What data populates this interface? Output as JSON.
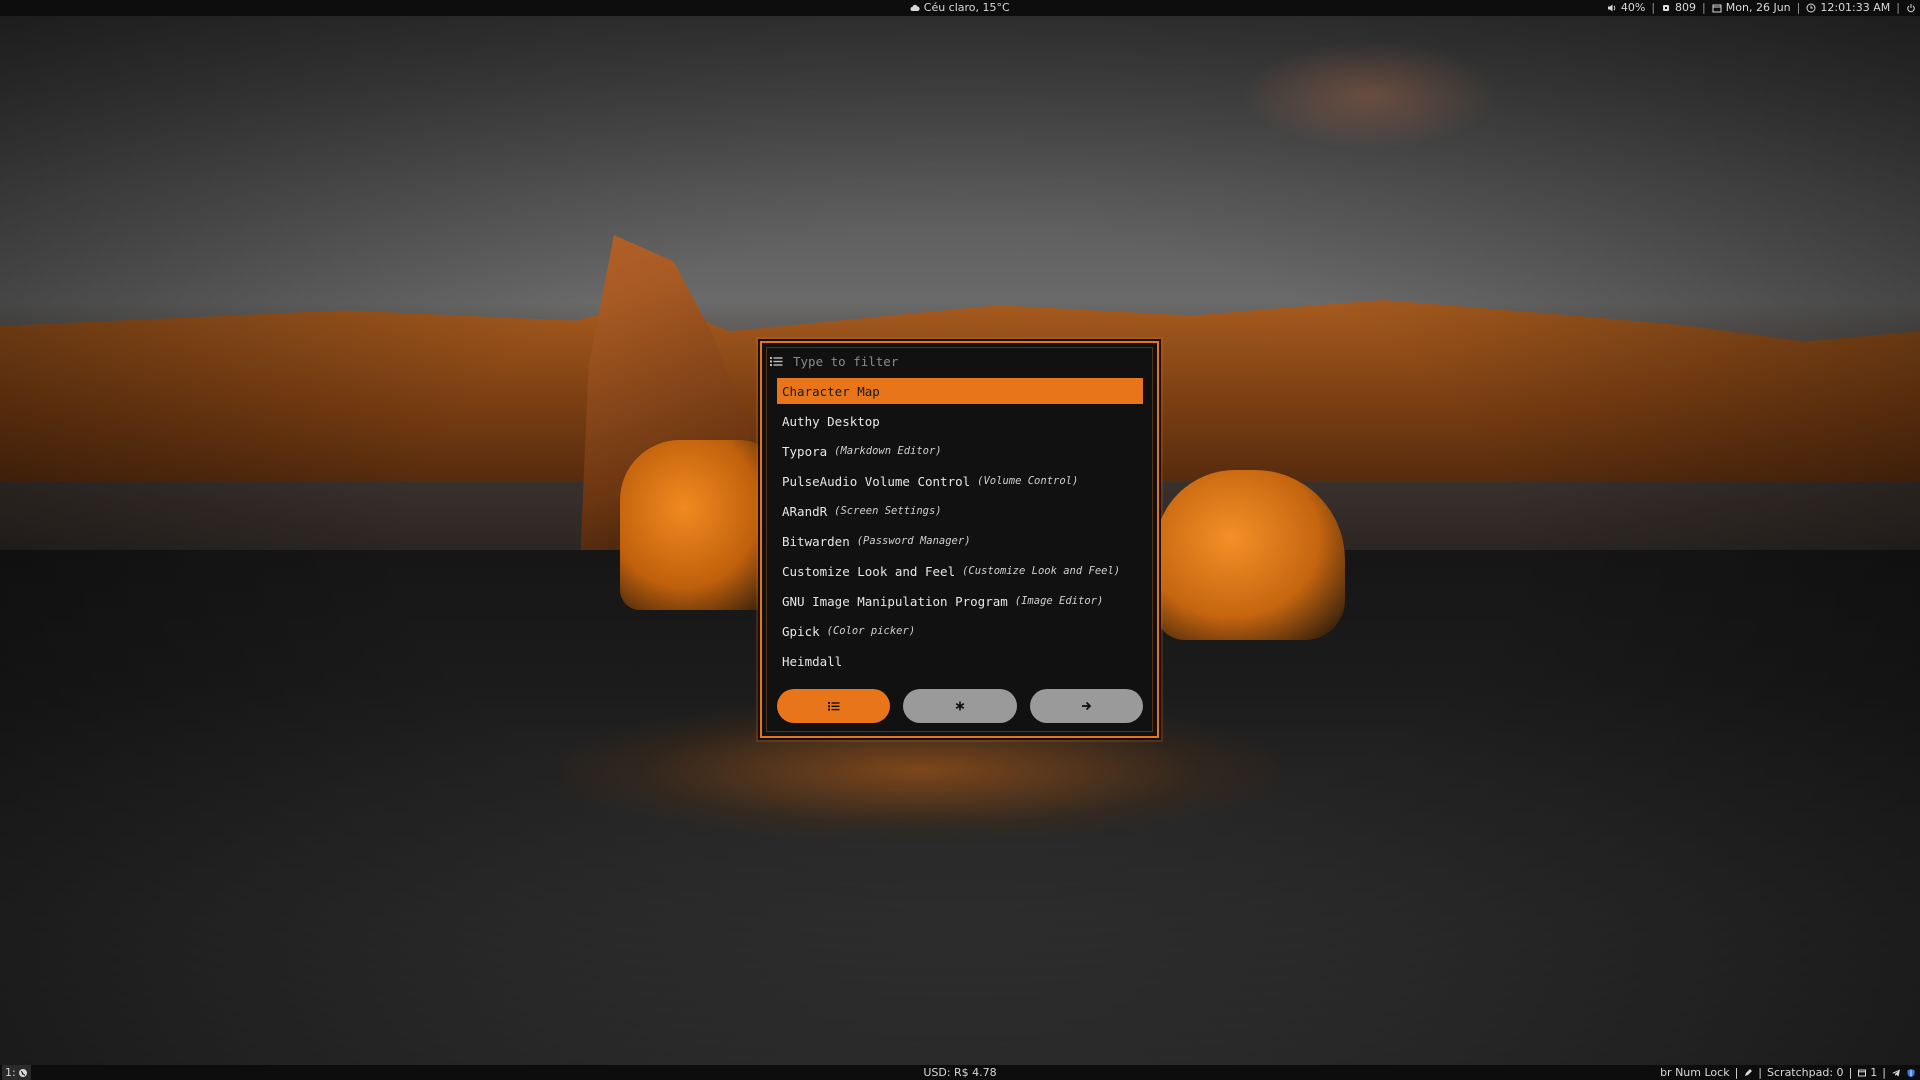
{
  "top_bar": {
    "weather": {
      "icon": "cloud-icon",
      "text": "Céu claro, 15°C"
    },
    "volume": {
      "icon": "speaker-icon",
      "text": "40%"
    },
    "memory": {
      "icon": "chip-icon",
      "text": "809"
    },
    "date": {
      "icon": "calendar-icon",
      "text": "Mon, 26 Jun"
    },
    "time": {
      "icon": "clock-icon",
      "text": "12:01:33 AM"
    },
    "power": {
      "icon": "power-icon"
    },
    "separator": "|"
  },
  "bottom_bar": {
    "workspace": {
      "label": "1:",
      "icon": "globe-icon"
    },
    "currency": "USD: R$ 4.78",
    "keyboard": "br Num Lock",
    "edit_icon": "pencil-icon",
    "scratchpad": "Scratchpad: 0",
    "windows": {
      "icon": "window-icon",
      "text": "1"
    },
    "tray": [
      "telegram-icon",
      "shield-icon"
    ],
    "separator": "|"
  },
  "launcher": {
    "accent": "#e8751a",
    "search": {
      "icon": "list-icon",
      "placeholder": "Type to filter",
      "value": ""
    },
    "items": [
      {
        "name": "Character Map",
        "generic": "",
        "selected": true
      },
      {
        "name": "Authy Desktop",
        "generic": ""
      },
      {
        "name": "Typora",
        "generic": "(Markdown Editor)"
      },
      {
        "name": "PulseAudio Volume Control",
        "generic": "(Volume Control)"
      },
      {
        "name": "ARandR",
        "generic": "(Screen Settings)"
      },
      {
        "name": "Bitwarden",
        "generic": "(Password Manager)"
      },
      {
        "name": "Customize Look and Feel",
        "generic": "(Customize Look and Feel)"
      },
      {
        "name": "GNU Image Manipulation Program",
        "generic": "(Image Editor)"
      },
      {
        "name": "Gpick",
        "generic": "(Color picker)"
      },
      {
        "name": "Heimdall",
        "generic": ""
      }
    ],
    "mode_buttons": [
      {
        "icon": "list-icon",
        "active": true
      },
      {
        "icon": "asterisk-icon",
        "active": false
      },
      {
        "icon": "arrow-right-icon",
        "active": false
      }
    ]
  }
}
